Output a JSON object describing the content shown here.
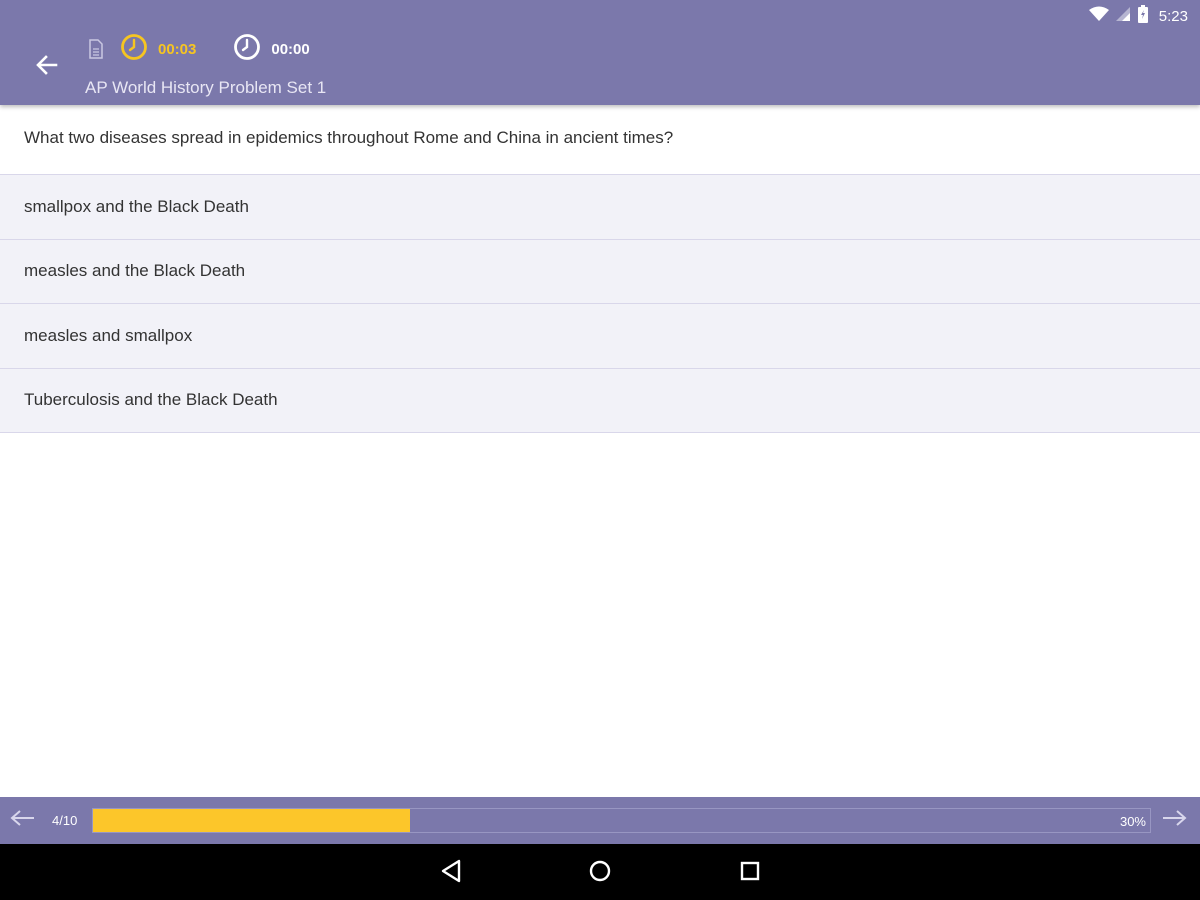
{
  "status_bar": {
    "time": "5:23",
    "icons": [
      "wifi-icon",
      "signal-icon",
      "battery-icon"
    ]
  },
  "header": {
    "back_icon": "arrow-left-icon",
    "document_icon": "document-icon",
    "timer_elapsed": {
      "icon": "clock-icon",
      "value": "00:03",
      "color": "#f6c521"
    },
    "timer_total": {
      "icon": "clock-icon",
      "value": "00:00",
      "color": "#ffffff"
    },
    "title": "AP World History Problem Set 1"
  },
  "question": {
    "text": "What two diseases spread in epidemics throughout Rome and China in ancient times?"
  },
  "options": [
    {
      "label": "smallpox and the Black Death"
    },
    {
      "label": "measles and the Black Death"
    },
    {
      "label": "measles and smallpox"
    },
    {
      "label": "Tuberculosis and the Black Death"
    }
  ],
  "progress": {
    "count": "4/10",
    "percent_label": "30%",
    "fraction": 0.3,
    "prev_icon": "arrow-left-icon",
    "next_icon": "arrow-right-icon",
    "fill_color": "#fcc62a"
  },
  "system_nav": {
    "buttons": [
      "back-triangle-icon",
      "home-circle-icon",
      "recents-square-icon"
    ]
  },
  "colors": {
    "primary": "#7b78ab",
    "accent": "#fcc62a",
    "option_bg": "#f2f2f8"
  }
}
